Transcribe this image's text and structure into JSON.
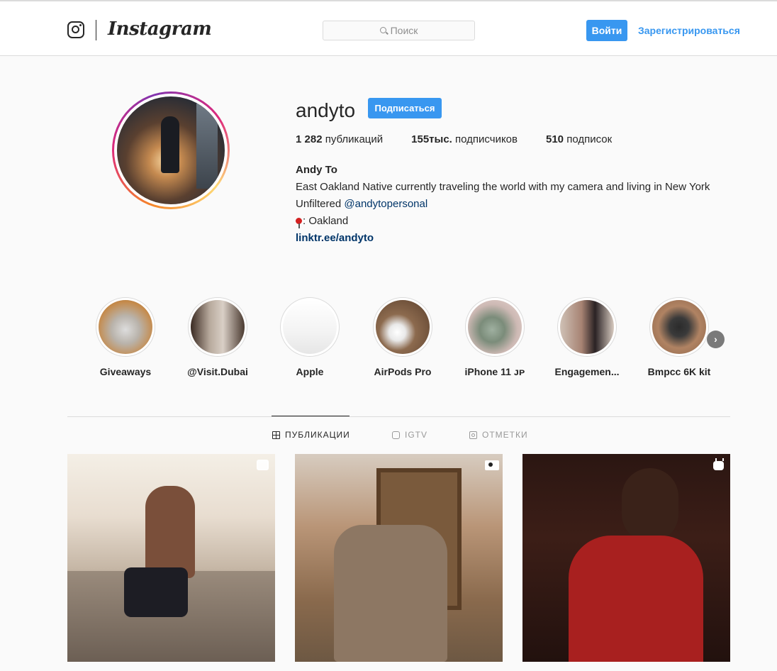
{
  "header": {
    "wordmark": "Instagram",
    "search_placeholder": "Поиск",
    "login_label": "Войти",
    "register_label": "Зарегистрироваться"
  },
  "profile": {
    "username": "andyto",
    "follow_label": "Подписаться",
    "stats": {
      "posts_count": "1 282",
      "posts_label": "публикаций",
      "followers_count": "155тыс.",
      "followers_label": "подписчиков",
      "following_count": "510",
      "following_label": "подписок"
    },
    "bio": {
      "full_name": "Andy To",
      "line1": "East Oakland Native currently traveling the world with my camera and living in New York",
      "line2_prefix": "Unfiltered ",
      "line2_mention": "@andytopersonal",
      "location": ": Oakland",
      "link": "linktr.ee/andyto"
    }
  },
  "highlights": [
    {
      "label": "Giveaways"
    },
    {
      "label": "@Visit.Dubai"
    },
    {
      "label": " Apple"
    },
    {
      "label": "AirPods Pro"
    },
    {
      "label": "iPhone 11 ᴊᴘ"
    },
    {
      "label": "Engagemen..."
    },
    {
      "label": "Bmpcc 6K kit"
    }
  ],
  "tabs": [
    {
      "label": "ПУБЛИКАЦИИ",
      "icon": "grid-icon",
      "active": true
    },
    {
      "label": "IGTV",
      "icon": "igtv-icon",
      "active": false
    },
    {
      "label": "ОТМЕТКИ",
      "icon": "tagged-icon",
      "active": false
    }
  ],
  "posts": [
    {
      "badge": "multi-photo-icon"
    },
    {
      "badge": "video-icon"
    },
    {
      "badge": "igtv-icon"
    }
  ],
  "colors": {
    "accent": "#3897f0",
    "link": "#003569",
    "text": "#262626",
    "background": "#fafafa"
  }
}
